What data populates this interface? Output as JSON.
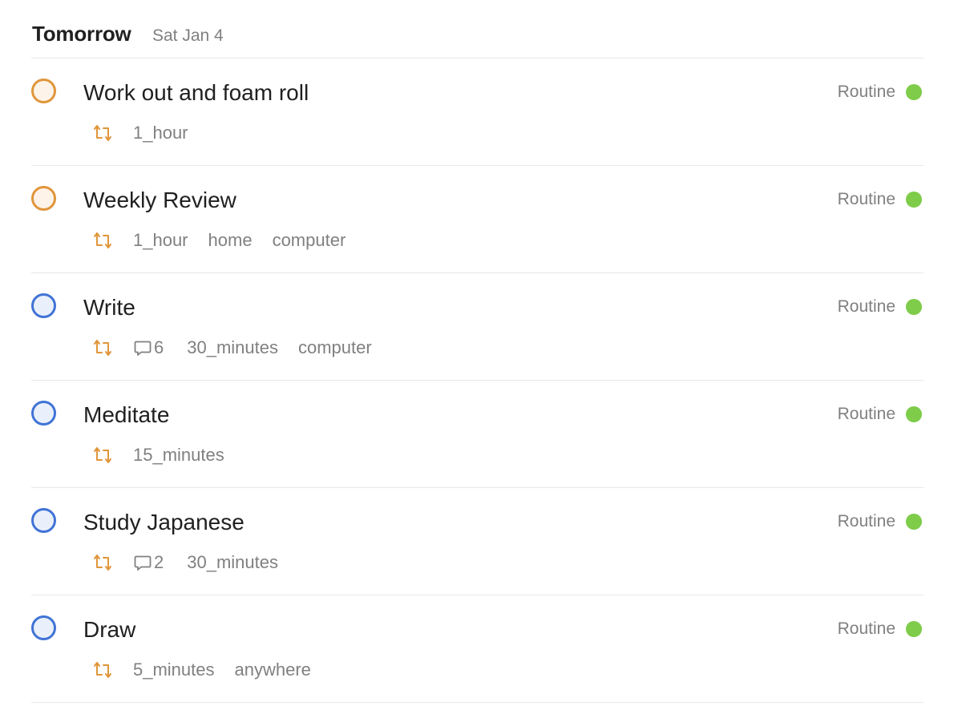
{
  "section": {
    "title": "Tomorrow",
    "date": "Sat Jan 4"
  },
  "colors": {
    "priority_orange": "#e0963b",
    "priority_blue": "#4073d6",
    "project_green": "#7ecc49",
    "recurring_icon": "#e0963b",
    "meta_text": "#808080"
  },
  "tasks": [
    {
      "title": "Work out and foam roll",
      "priority_color": "orange",
      "recurring_icon": "recurring-icon",
      "comments": null,
      "labels": [
        "1_hour"
      ],
      "project": "Routine"
    },
    {
      "title": "Weekly Review",
      "priority_color": "orange",
      "recurring_icon": "recurring-icon",
      "comments": null,
      "labels": [
        "1_hour",
        "home",
        "computer"
      ],
      "project": "Routine"
    },
    {
      "title": "Write",
      "priority_color": "blue",
      "recurring_icon": "recurring-icon",
      "comments": "6",
      "labels": [
        "30_minutes",
        "computer"
      ],
      "project": "Routine"
    },
    {
      "title": "Meditate",
      "priority_color": "blue",
      "recurring_icon": "recurring-icon",
      "comments": null,
      "labels": [
        "15_minutes"
      ],
      "project": "Routine"
    },
    {
      "title": "Study Japanese",
      "priority_color": "blue",
      "recurring_icon": "recurring-icon",
      "comments": "2",
      "labels": [
        "30_minutes"
      ],
      "project": "Routine"
    },
    {
      "title": "Draw",
      "priority_color": "blue",
      "recurring_icon": "recurring-icon",
      "comments": null,
      "labels": [
        "5_minutes",
        "anywhere"
      ],
      "project": "Routine"
    }
  ]
}
